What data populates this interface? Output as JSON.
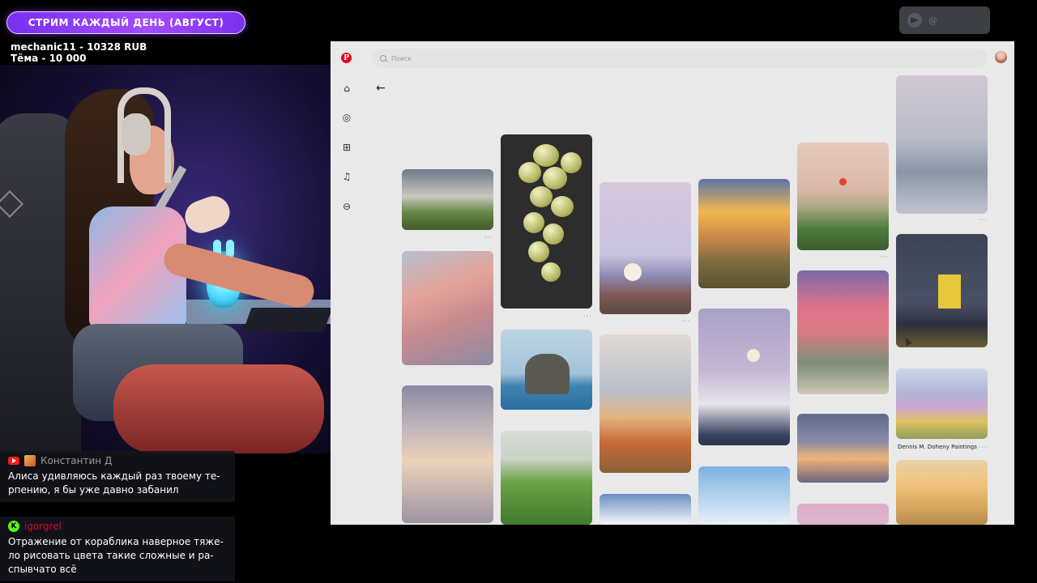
{
  "overlay": {
    "banner": "СТРИМ КАЖДЫЙ ДЕНЬ (АВГУСТ)",
    "donation_line1": "mechanic11 - 10328 RUB",
    "donation_line2": "Тёма - 10 000",
    "telegram_label": "@"
  },
  "chat": [
    {
      "platform": "youtube",
      "user": "Константин Д",
      "user_color": "#9a9a9a",
      "text": "Алиса удивляюсь каждый раз твоему те-рпению, я бы уже давно забанил"
    },
    {
      "platform": "kick",
      "user": "igorgrel",
      "user_color": "#c8102e",
      "text": "Отражение от кораблика наверное тяже-ло рисовать цвета такие сложные и ра-спывчато всё"
    }
  ],
  "pinterest": {
    "search_placeholder": "Поиск",
    "brand_color": "#e60023",
    "sidebar_icons": [
      "home-icon",
      "explore-icon",
      "create-icon",
      "notifications-icon",
      "messages-icon"
    ],
    "pin_caption": "Dennis M. Doheny Paintings",
    "pin_more": "···"
  }
}
